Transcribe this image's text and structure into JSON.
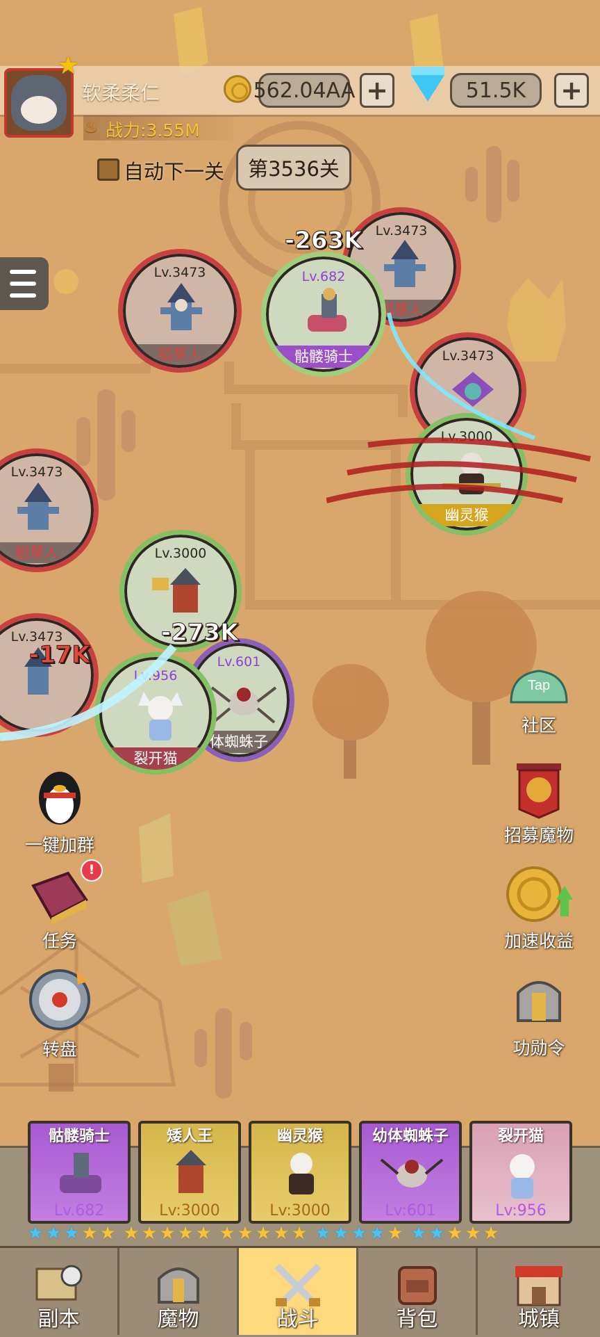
{
  "player": {
    "name": "软柔柔仁",
    "power": "战力:3.55M"
  },
  "currency": {
    "gold": "562.04AA",
    "gems": "51.5K",
    "add_symbol": "+"
  },
  "stage": {
    "auto_next_label": "自动下一关",
    "current_stage": "第3536关"
  },
  "battle": {
    "enemies": [
      {
        "level": "Lv.3473",
        "name": "稻草人"
      },
      {
        "level": "Lv.3473",
        "name": "稻草人"
      },
      {
        "level": "Lv.3473",
        "name": ""
      },
      {
        "level": "Lv.3473",
        "name": "稻草人"
      },
      {
        "level": "Lv.3473",
        "name": ""
      }
    ],
    "allies": [
      {
        "level": "Lv.682",
        "name": "骷髅骑士"
      },
      {
        "level": "Lv.3000",
        "name": "幽灵猴"
      },
      {
        "level": "Lv.3000",
        "name": ""
      },
      {
        "level": "Lv.601",
        "name": "体蜘蛛子"
      },
      {
        "level": "Lv.956",
        "name": "裂开猫"
      }
    ],
    "damage_numbers": [
      "-263K",
      "-273K",
      "-17K"
    ]
  },
  "side_features": {
    "community": "社区",
    "community_icon_text": "Tap",
    "recruit": "招募魔物",
    "speed_up": "加速收益",
    "merit": "功勋令",
    "join_group": "一键加群",
    "quest": "任务",
    "quest_badge": "!",
    "wheel": "转盘"
  },
  "team": [
    {
      "name": "骷髅骑士",
      "level": "Lv.682",
      "rarity": "purple"
    },
    {
      "name": "矮人王",
      "level": "Lv:3000",
      "rarity": "gold"
    },
    {
      "name": "幽灵猴",
      "level": "Lv:3000",
      "rarity": "gold"
    },
    {
      "name": "幼体蜘蛛子",
      "level": "Lv:601",
      "rarity": "purple"
    },
    {
      "name": "裂开猫",
      "level": "Lv:956",
      "rarity": "pink"
    }
  ],
  "nav": {
    "tabs": [
      "副本",
      "魔物",
      "战斗",
      "背包",
      "城镇"
    ],
    "active_tab": "战斗"
  },
  "colors": {
    "enemy_ring": "#c94040",
    "ally_ring": "#85c064",
    "active_tab": "#ffd97d",
    "background": "#d9a66b"
  }
}
